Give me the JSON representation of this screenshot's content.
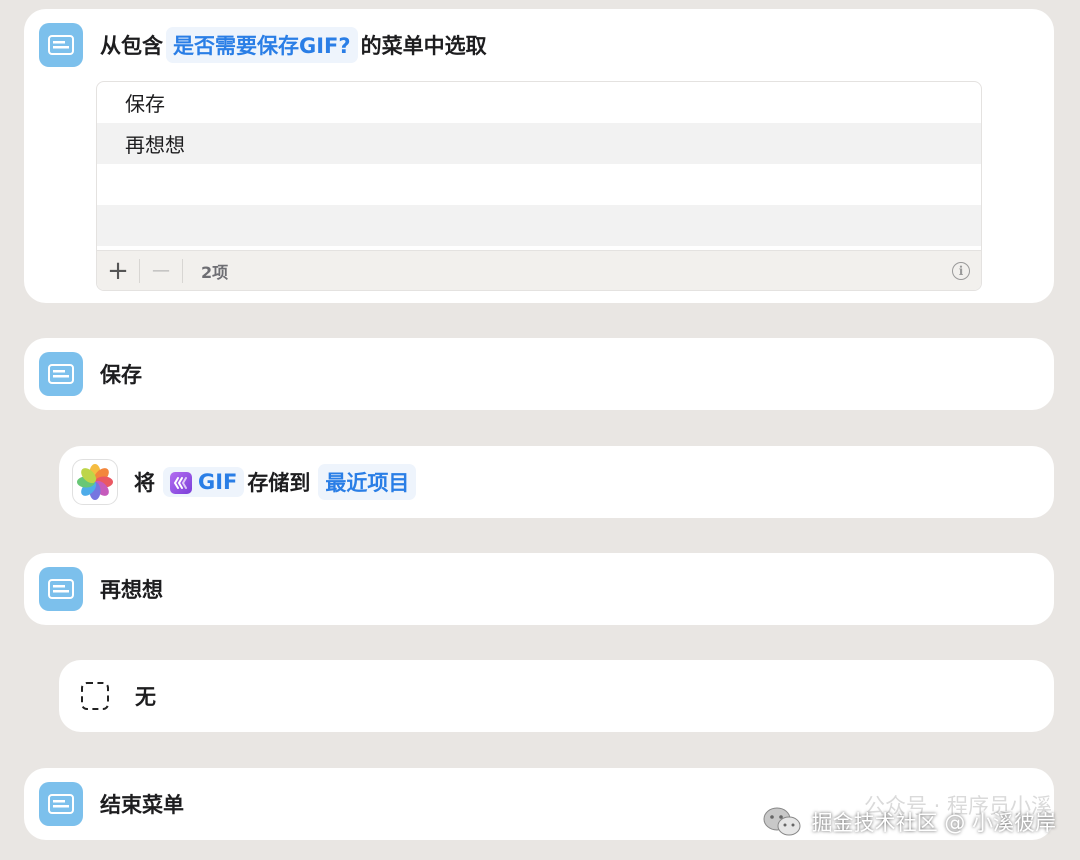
{
  "choose_menu": {
    "prefix": "从包含",
    "prompt_chip": "是否需要保存GIF?",
    "suffix": "的菜单中选取",
    "items": [
      "保存",
      "再想想"
    ],
    "add_label": "+",
    "remove_label": "—",
    "count": "2项",
    "info_label": "i"
  },
  "case_save": {
    "label": "保存"
  },
  "save_action": {
    "verb": "将",
    "gif_label": "GIF",
    "middle": "存储到",
    "album_chip": "最近项目",
    "icon": "photos-icon"
  },
  "case_rethink": {
    "label": "再想想"
  },
  "nothing_action": {
    "label": "无",
    "icon": "dashed-square-icon"
  },
  "end_menu": {
    "label": "结束菜单"
  },
  "watermark": {
    "ghost_text": "公众号 · 程序员小溪",
    "text": "掘金技术社区 @ 小溪彼岸"
  },
  "colors": {
    "background": "#e9e6e3",
    "menu_icon": "#7cc0ec",
    "chip_text": "#2a7ee6",
    "gif_badge": "#9b55e6"
  }
}
